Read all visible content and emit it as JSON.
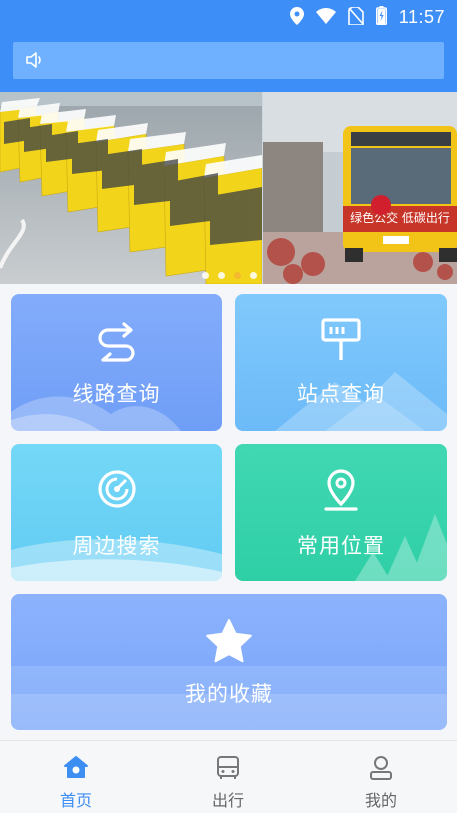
{
  "status_bar": {
    "time": "11:57",
    "icons": [
      "location-icon",
      "wifi-icon",
      "no-sim-icon",
      "battery-charging-icon"
    ]
  },
  "notice_bar": {
    "icon": "speaker-icon",
    "text": ""
  },
  "banner": {
    "slide_count": 4,
    "active_index": 2,
    "bus_sign_text": "绿色公交 低碳出行"
  },
  "menu": {
    "route_query": {
      "label": "线路查询",
      "icon": "route-arrows-icon",
      "color": "#7aa7f8"
    },
    "station_query": {
      "label": "站点查询",
      "icon": "bus-stop-sign-icon",
      "color": "#76c3fb"
    },
    "nearby_search": {
      "label": "周边搜索",
      "icon": "radar-icon",
      "color": "#6fd3f5"
    },
    "common_places": {
      "label": "常用位置",
      "icon": "map-pin-icon",
      "color": "#39d3ad"
    },
    "favorites": {
      "label": "我的收藏",
      "icon": "star-icon",
      "color": "#86acfb"
    }
  },
  "tabs": [
    {
      "label": "首页",
      "icon": "home-icon",
      "active": true
    },
    {
      "label": "出行",
      "icon": "bus-icon",
      "active": false
    },
    {
      "label": "我的",
      "icon": "person-icon",
      "active": false
    }
  ],
  "colors": {
    "primary": "#3e8ef7",
    "tab_active": "#3d8ef2",
    "tab_inactive": "#666666",
    "dot_active": "#f5b82e"
  }
}
